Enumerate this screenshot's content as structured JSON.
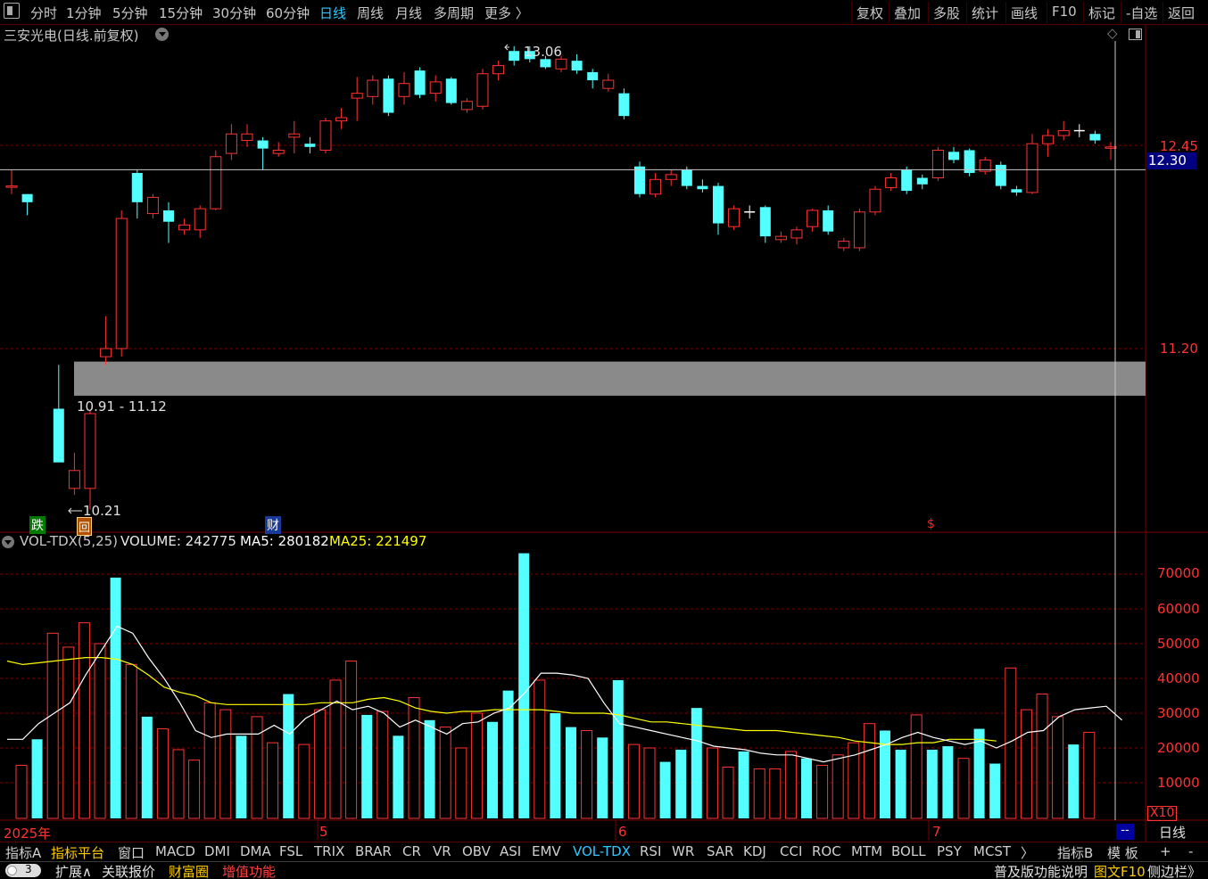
{
  "toolbar": {
    "menu_icon": "window-icon",
    "periods": [
      "分时",
      "1分钟",
      "5分钟",
      "15分钟",
      "30分钟",
      "60分钟",
      "日线",
      "周线",
      "月线",
      "多周期",
      "更多 〉"
    ],
    "active_period": "日线",
    "actions": [
      "复权",
      "叠加",
      "多股",
      "统计",
      "画线",
      "F10",
      "标记",
      "-自选",
      "返回"
    ]
  },
  "stock": {
    "title": "三安光电(日线.前复权)"
  },
  "price_axis": {
    "labels": [
      "12.45",
      "11.20"
    ],
    "current_price": "12.30"
  },
  "annotations": {
    "high": "13.06",
    "low": "10.21",
    "range": "10.91 - 11.12"
  },
  "markers": {
    "fall": "跌",
    "back": "回",
    "finance": "财",
    "dollar": "$"
  },
  "volume": {
    "indicator": "VOL-TDX(5,25)",
    "volume_label": "VOLUME: 242775",
    "ma5_label": "MA5: 280182",
    "ma25_label": "MA25: 221497",
    "axis_labels": [
      "70000",
      "60000",
      "50000",
      "40000",
      "30000",
      "20000",
      "10000"
    ],
    "multiplier": "X10"
  },
  "date_axis": {
    "year_label": "2025年",
    "months": [
      "5",
      "6",
      "7"
    ],
    "period_button": "日线",
    "dash_button": "--"
  },
  "indicator_tabs": [
    "指标A",
    "指标平台",
    "窗口",
    "MACD",
    "DMI",
    "DMA",
    "FSL",
    "TRIX",
    "BRAR",
    "CR",
    "VR",
    "OBV",
    "ASI",
    "EMV",
    "VOL-TDX",
    "RSI",
    "WR",
    "SAR",
    "KDJ",
    "CCI",
    "ROC",
    "MTM",
    "BOLL",
    "PSY",
    "MCST",
    "〉",
    "指标B",
    "模 板",
    "+",
    "-"
  ],
  "active_indicator": "VOL-TDX",
  "statusbar": {
    "toggle": "3",
    "items": [
      "扩展∧",
      "关联报价",
      "财富圈",
      "增值功能"
    ],
    "right_text": "普及版功能说明",
    "right_link": "图文F10",
    "sidebar": "侧边栏》"
  },
  "colors": {
    "up": "#ff3232",
    "down": "#54ffff",
    "ma5": "#ffffff",
    "ma25": "#ffff00",
    "grid": "#7a0000",
    "accent": "#30c8ff"
  },
  "chart_data": {
    "type": "candlestick",
    "price_ylim": [
      10.0,
      13.4
    ],
    "candles": [
      {
        "o": 12.2,
        "c": 12.2,
        "h": 12.3,
        "l": 12.15,
        "d": "up"
      },
      {
        "o": 12.15,
        "c": 12.1,
        "h": 12.15,
        "l": 12.02,
        "d": "down"
      },
      {
        "o": 10.5,
        "c": 10.5,
        "h": 10.5,
        "l": 10.5,
        "d": "skip"
      },
      {
        "o": 10.83,
        "c": 10.5,
        "h": 11.1,
        "l": 10.5,
        "d": "down"
      },
      {
        "o": 10.34,
        "c": 10.45,
        "h": 10.56,
        "l": 10.3,
        "d": "up"
      },
      {
        "o": 10.34,
        "c": 10.8,
        "h": 10.82,
        "l": 10.21,
        "d": "up"
      },
      {
        "o": 11.15,
        "c": 11.2,
        "h": 11.4,
        "l": 11.1,
        "d": "up"
      },
      {
        "o": 11.2,
        "c": 12.0,
        "h": 12.05,
        "l": 11.15,
        "d": "up"
      },
      {
        "o": 12.28,
        "c": 12.1,
        "h": 12.3,
        "l": 12.0,
        "d": "down"
      },
      {
        "o": 12.03,
        "c": 12.13,
        "h": 12.15,
        "l": 12.0,
        "d": "up"
      },
      {
        "o": 12.05,
        "c": 11.98,
        "h": 12.1,
        "l": 11.85,
        "d": "down"
      },
      {
        "o": 11.93,
        "c": 11.96,
        "h": 12.0,
        "l": 11.9,
        "d": "up"
      },
      {
        "o": 11.93,
        "c": 12.06,
        "h": 12.08,
        "l": 11.88,
        "d": "up"
      },
      {
        "o": 12.06,
        "c": 12.38,
        "h": 12.42,
        "l": 12.05,
        "d": "up"
      },
      {
        "o": 12.4,
        "c": 12.52,
        "h": 12.58,
        "l": 12.36,
        "d": "up"
      },
      {
        "o": 12.48,
        "c": 12.52,
        "h": 12.58,
        "l": 12.44,
        "d": "up"
      },
      {
        "o": 12.48,
        "c": 12.43,
        "h": 12.5,
        "l": 12.3,
        "d": "down"
      },
      {
        "o": 12.4,
        "c": 12.42,
        "h": 12.47,
        "l": 12.38,
        "d": "up"
      },
      {
        "o": 12.5,
        "c": 12.52,
        "h": 12.6,
        "l": 12.4,
        "d": "up"
      },
      {
        "o": 12.46,
        "c": 12.44,
        "h": 12.5,
        "l": 12.4,
        "d": "down"
      },
      {
        "o": 12.42,
        "c": 12.6,
        "h": 12.62,
        "l": 12.4,
        "d": "up"
      },
      {
        "o": 12.6,
        "c": 12.62,
        "h": 12.68,
        "l": 12.55,
        "d": "up"
      },
      {
        "o": 12.74,
        "c": 12.77,
        "h": 12.87,
        "l": 12.6,
        "d": "up"
      },
      {
        "o": 12.75,
        "c": 12.85,
        "h": 12.88,
        "l": 12.7,
        "d": "up"
      },
      {
        "o": 12.86,
        "c": 12.65,
        "h": 12.88,
        "l": 12.63,
        "d": "down"
      },
      {
        "o": 12.75,
        "c": 12.83,
        "h": 12.9,
        "l": 12.7,
        "d": "up"
      },
      {
        "o": 12.91,
        "c": 12.76,
        "h": 12.93,
        "l": 12.74,
        "d": "down"
      },
      {
        "o": 12.77,
        "c": 12.84,
        "h": 12.88,
        "l": 12.72,
        "d": "up"
      },
      {
        "o": 12.86,
        "c": 12.71,
        "h": 12.87,
        "l": 12.7,
        "d": "down"
      },
      {
        "o": 12.67,
        "c": 12.72,
        "h": 12.74,
        "l": 12.65,
        "d": "up"
      },
      {
        "o": 12.69,
        "c": 12.89,
        "h": 12.92,
        "l": 12.67,
        "d": "up"
      },
      {
        "o": 12.89,
        "c": 12.94,
        "h": 12.97,
        "l": 12.85,
        "d": "up"
      },
      {
        "o": 13.03,
        "c": 12.97,
        "h": 13.06,
        "l": 12.94,
        "d": "down"
      },
      {
        "o": 13.03,
        "c": 12.98,
        "h": 13.06,
        "l": 12.96,
        "d": "down"
      },
      {
        "o": 12.98,
        "c": 12.93,
        "h": 13.0,
        "l": 12.92,
        "d": "down"
      },
      {
        "o": 12.92,
        "c": 12.98,
        "h": 13.0,
        "l": 12.9,
        "d": "up"
      },
      {
        "o": 12.97,
        "c": 12.91,
        "h": 13.01,
        "l": 12.89,
        "d": "down"
      },
      {
        "o": 12.9,
        "c": 12.85,
        "h": 12.92,
        "l": 12.8,
        "d": "down"
      },
      {
        "o": 12.8,
        "c": 12.85,
        "h": 12.89,
        "l": 12.78,
        "d": "up"
      },
      {
        "o": 12.77,
        "c": 12.63,
        "h": 12.8,
        "l": 12.61,
        "d": "down"
      },
      {
        "o": 12.32,
        "c": 12.15,
        "h": 12.35,
        "l": 12.13,
        "d": "down"
      },
      {
        "o": 12.15,
        "c": 12.24,
        "h": 12.28,
        "l": 12.13,
        "d": "up"
      },
      {
        "o": 12.24,
        "c": 12.27,
        "h": 12.3,
        "l": 12.2,
        "d": "up"
      },
      {
        "o": 12.3,
        "c": 12.2,
        "h": 12.32,
        "l": 12.18,
        "d": "down"
      },
      {
        "o": 12.18,
        "c": 12.2,
        "h": 12.24,
        "l": 12.16,
        "d": "down"
      },
      {
        "o": 12.2,
        "c": 11.97,
        "h": 12.22,
        "l": 11.9,
        "d": "down"
      },
      {
        "o": 11.95,
        "c": 12.06,
        "h": 12.08,
        "l": 11.93,
        "d": "up"
      },
      {
        "o": 12.04,
        "c": 12.04,
        "h": 12.08,
        "l": 12.0,
        "d": "flat"
      },
      {
        "o": 12.07,
        "c": 11.89,
        "h": 12.08,
        "l": 11.85,
        "d": "down"
      },
      {
        "o": 11.87,
        "c": 11.89,
        "h": 11.92,
        "l": 11.85,
        "d": "up"
      },
      {
        "o": 11.88,
        "c": 11.93,
        "h": 11.95,
        "l": 11.84,
        "d": "up"
      },
      {
        "o": 11.95,
        "c": 12.05,
        "h": 12.06,
        "l": 11.92,
        "d": "up"
      },
      {
        "o": 12.05,
        "c": 11.92,
        "h": 12.08,
        "l": 11.9,
        "d": "down"
      },
      {
        "o": 11.82,
        "c": 11.86,
        "h": 11.88,
        "l": 11.8,
        "d": "up"
      },
      {
        "o": 11.82,
        "c": 12.04,
        "h": 12.06,
        "l": 11.8,
        "d": "up"
      },
      {
        "o": 12.04,
        "c": 12.18,
        "h": 12.2,
        "l": 12.02,
        "d": "up"
      },
      {
        "o": 12.19,
        "c": 12.25,
        "h": 12.28,
        "l": 12.17,
        "d": "up"
      },
      {
        "o": 12.3,
        "c": 12.17,
        "h": 12.32,
        "l": 12.15,
        "d": "down"
      },
      {
        "o": 12.25,
        "c": 12.21,
        "h": 12.27,
        "l": 12.18,
        "d": "down"
      },
      {
        "o": 12.25,
        "c": 12.42,
        "h": 12.44,
        "l": 12.23,
        "d": "up"
      },
      {
        "o": 12.41,
        "c": 12.36,
        "h": 12.44,
        "l": 12.34,
        "d": "down"
      },
      {
        "o": 12.42,
        "c": 12.28,
        "h": 12.43,
        "l": 12.26,
        "d": "down"
      },
      {
        "o": 12.29,
        "c": 12.36,
        "h": 12.38,
        "l": 12.27,
        "d": "up"
      },
      {
        "o": 12.33,
        "c": 12.2,
        "h": 12.35,
        "l": 12.18,
        "d": "down"
      },
      {
        "o": 12.18,
        "c": 12.16,
        "h": 12.2,
        "l": 12.14,
        "d": "down"
      },
      {
        "o": 12.16,
        "c": 12.46,
        "h": 12.52,
        "l": 12.15,
        "d": "up"
      },
      {
        "o": 12.46,
        "c": 12.51,
        "h": 12.55,
        "l": 12.38,
        "d": "up"
      },
      {
        "o": 12.51,
        "c": 12.54,
        "h": 12.6,
        "l": 12.48,
        "d": "up"
      },
      {
        "o": 12.54,
        "c": 12.54,
        "h": 12.58,
        "l": 12.5,
        "d": "flat"
      },
      {
        "o": 12.52,
        "c": 12.48,
        "h": 12.54,
        "l": 12.46,
        "d": "down"
      },
      {
        "o": 12.44,
        "c": 12.44,
        "h": 12.47,
        "l": 12.36,
        "d": "up"
      }
    ],
    "volumes": [
      15,
      22.5,
      53,
      49,
      56,
      50,
      69,
      44,
      29,
      25.5,
      19.5,
      16.5,
      33,
      31,
      23.5,
      29,
      21.5,
      35.5,
      21,
      31,
      39.5,
      45,
      29.5,
      30.5,
      23.5,
      34.5,
      28,
      26,
      20,
      30,
      27.5,
      36.5,
      76,
      39.5,
      30,
      26,
      25,
      23,
      39.5,
      21,
      20,
      16,
      19.5,
      31.5,
      20,
      14.5,
      19,
      14,
      14,
      19,
      17,
      15,
      18,
      21.5,
      27,
      25,
      19.5,
      29.5,
      19.5,
      20.5,
      17,
      25.5,
      15.5,
      43,
      31,
      35.5,
      29,
      21,
      24.5
    ],
    "vol_ylim": [
      0,
      78000
    ],
    "ma5_line": [
      22.5,
      22.5,
      27,
      30,
      33,
      41,
      48,
      55,
      53,
      46,
      40,
      33,
      25,
      23,
      24,
      24,
      24,
      26.5,
      24,
      28.5,
      31,
      33.5,
      31,
      32,
      30,
      26,
      28,
      26,
      24,
      27,
      27.5,
      30,
      31.5,
      36,
      41.5,
      41.5,
      41,
      40,
      33,
      27,
      26,
      25,
      24,
      23,
      22,
      20.5,
      20,
      19.5,
      18.5,
      18,
      18,
      17,
      16,
      17,
      18,
      19.5,
      21,
      23,
      24.5,
      23,
      22,
      21,
      22,
      20,
      22,
      24.5,
      25,
      29,
      31,
      31.5,
      32,
      28
    ],
    "ma25_line": [
      45,
      44,
      44.5,
      45,
      45.5,
      46,
      46,
      45.5,
      44,
      41,
      37.5,
      36,
      35,
      33,
      32.5,
      32.5,
      32.5,
      32.5,
      32.5,
      32.5,
      33,
      33,
      33,
      34,
      34.5,
      33.5,
      31.5,
      30.5,
      30,
      30.5,
      30.5,
      31,
      31,
      31,
      31,
      30.5,
      30,
      30,
      30,
      29.5,
      28.5,
      27.5,
      27.5,
      27,
      26.5,
      26,
      25.5,
      25,
      25,
      25,
      24.5,
      24,
      23.5,
      23,
      22,
      21.5,
      21,
      21,
      21.5,
      21.5,
      22.5,
      22.5,
      22.5,
      22
    ]
  }
}
